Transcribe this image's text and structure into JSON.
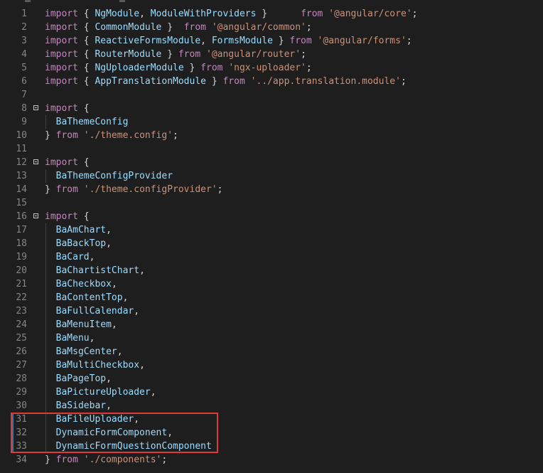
{
  "editor": {
    "lines": [
      {
        "n": "1",
        "fold": false,
        "indent": false,
        "mod": false,
        "t": [
          [
            "kw",
            "import"
          ],
          [
            "pn",
            " { "
          ],
          [
            "id",
            "NgModule"
          ],
          [
            "pn",
            ", "
          ],
          [
            "id",
            "ModuleWithProviders"
          ],
          [
            "pn",
            " }      "
          ],
          [
            "kw",
            "from"
          ],
          [
            "pn",
            " "
          ],
          [
            "str",
            "'@angular/core'"
          ],
          [
            "pn",
            ";"
          ]
        ]
      },
      {
        "n": "2",
        "fold": false,
        "indent": false,
        "mod": false,
        "t": [
          [
            "kw",
            "import"
          ],
          [
            "pn",
            " { "
          ],
          [
            "id",
            "CommonModule"
          ],
          [
            "pn",
            " }  "
          ],
          [
            "kw",
            "from"
          ],
          [
            "pn",
            " "
          ],
          [
            "str",
            "'@angular/common'"
          ],
          [
            "pn",
            ";"
          ]
        ]
      },
      {
        "n": "3",
        "fold": false,
        "indent": false,
        "mod": false,
        "t": [
          [
            "kw",
            "import"
          ],
          [
            "pn",
            " { "
          ],
          [
            "id",
            "ReactiveFormsModule"
          ],
          [
            "pn",
            ", "
          ],
          [
            "id",
            "FormsModule"
          ],
          [
            "pn",
            " } "
          ],
          [
            "kw",
            "from"
          ],
          [
            "pn",
            " "
          ],
          [
            "str",
            "'@angular/forms'"
          ],
          [
            "pn",
            ";"
          ]
        ]
      },
      {
        "n": "4",
        "fold": false,
        "indent": false,
        "mod": false,
        "t": [
          [
            "kw",
            "import"
          ],
          [
            "pn",
            " { "
          ],
          [
            "id",
            "RouterModule"
          ],
          [
            "pn",
            " } "
          ],
          [
            "kw",
            "from"
          ],
          [
            "pn",
            " "
          ],
          [
            "str",
            "'@angular/router'"
          ],
          [
            "pn",
            ";"
          ]
        ]
      },
      {
        "n": "5",
        "fold": false,
        "indent": false,
        "mod": false,
        "t": [
          [
            "kw",
            "import"
          ],
          [
            "pn",
            " { "
          ],
          [
            "id",
            "NgUploaderModule"
          ],
          [
            "pn",
            " } "
          ],
          [
            "kw",
            "from"
          ],
          [
            "pn",
            " "
          ],
          [
            "str",
            "'ngx-uploader'"
          ],
          [
            "pn",
            ";"
          ]
        ]
      },
      {
        "n": "6",
        "fold": false,
        "indent": false,
        "mod": false,
        "t": [
          [
            "kw",
            "import"
          ],
          [
            "pn",
            " { "
          ],
          [
            "id",
            "AppTranslationModule"
          ],
          [
            "pn",
            " } "
          ],
          [
            "kw",
            "from"
          ],
          [
            "pn",
            " "
          ],
          [
            "str",
            "'../app.translation.module'"
          ],
          [
            "pn",
            ";"
          ]
        ]
      },
      {
        "n": "7",
        "fold": false,
        "indent": false,
        "mod": false,
        "t": []
      },
      {
        "n": "8",
        "fold": true,
        "indent": false,
        "mod": false,
        "t": [
          [
            "kw",
            "import"
          ],
          [
            "pn",
            " {"
          ]
        ]
      },
      {
        "n": "9",
        "fold": false,
        "indent": true,
        "mod": false,
        "t": [
          [
            "pn",
            "  "
          ],
          [
            "id",
            "BaThemeConfig"
          ]
        ]
      },
      {
        "n": "10",
        "fold": false,
        "indent": false,
        "mod": false,
        "t": [
          [
            "pn",
            "} "
          ],
          [
            "kw",
            "from"
          ],
          [
            "pn",
            " "
          ],
          [
            "str",
            "'./theme.config'"
          ],
          [
            "pn",
            ";"
          ]
        ]
      },
      {
        "n": "11",
        "fold": false,
        "indent": false,
        "mod": false,
        "t": []
      },
      {
        "n": "12",
        "fold": true,
        "indent": false,
        "mod": false,
        "t": [
          [
            "kw",
            "import"
          ],
          [
            "pn",
            " {"
          ]
        ]
      },
      {
        "n": "13",
        "fold": false,
        "indent": true,
        "mod": false,
        "t": [
          [
            "pn",
            "  "
          ],
          [
            "id",
            "BaThemeConfigProvider"
          ]
        ]
      },
      {
        "n": "14",
        "fold": false,
        "indent": false,
        "mod": false,
        "t": [
          [
            "pn",
            "} "
          ],
          [
            "kw",
            "from"
          ],
          [
            "pn",
            " "
          ],
          [
            "str",
            "'./theme.configProvider'"
          ],
          [
            "pn",
            ";"
          ]
        ]
      },
      {
        "n": "15",
        "fold": false,
        "indent": false,
        "mod": false,
        "t": []
      },
      {
        "n": "16",
        "fold": true,
        "indent": false,
        "mod": false,
        "t": [
          [
            "kw",
            "import"
          ],
          [
            "pn",
            " {"
          ]
        ]
      },
      {
        "n": "17",
        "fold": false,
        "indent": true,
        "mod": false,
        "t": [
          [
            "pn",
            "  "
          ],
          [
            "id",
            "BaAmChart"
          ],
          [
            "pn",
            ","
          ]
        ]
      },
      {
        "n": "18",
        "fold": false,
        "indent": true,
        "mod": false,
        "t": [
          [
            "pn",
            "  "
          ],
          [
            "id",
            "BaBackTop"
          ],
          [
            "pn",
            ","
          ]
        ]
      },
      {
        "n": "19",
        "fold": false,
        "indent": true,
        "mod": false,
        "t": [
          [
            "pn",
            "  "
          ],
          [
            "id",
            "BaCard"
          ],
          [
            "pn",
            ","
          ]
        ]
      },
      {
        "n": "20",
        "fold": false,
        "indent": true,
        "mod": false,
        "t": [
          [
            "pn",
            "  "
          ],
          [
            "id",
            "BaChartistChart"
          ],
          [
            "pn",
            ","
          ]
        ]
      },
      {
        "n": "21",
        "fold": false,
        "indent": true,
        "mod": false,
        "t": [
          [
            "pn",
            "  "
          ],
          [
            "id",
            "BaCheckbox"
          ],
          [
            "pn",
            ","
          ]
        ]
      },
      {
        "n": "22",
        "fold": false,
        "indent": true,
        "mod": false,
        "t": [
          [
            "pn",
            "  "
          ],
          [
            "id",
            "BaContentTop"
          ],
          [
            "pn",
            ","
          ]
        ]
      },
      {
        "n": "23",
        "fold": false,
        "indent": true,
        "mod": false,
        "t": [
          [
            "pn",
            "  "
          ],
          [
            "id",
            "BaFullCalendar"
          ],
          [
            "pn",
            ","
          ]
        ]
      },
      {
        "n": "24",
        "fold": false,
        "indent": true,
        "mod": false,
        "t": [
          [
            "pn",
            "  "
          ],
          [
            "id",
            "BaMenuItem"
          ],
          [
            "pn",
            ","
          ]
        ]
      },
      {
        "n": "25",
        "fold": false,
        "indent": true,
        "mod": false,
        "t": [
          [
            "pn",
            "  "
          ],
          [
            "id",
            "BaMenu"
          ],
          [
            "pn",
            ","
          ]
        ]
      },
      {
        "n": "26",
        "fold": false,
        "indent": true,
        "mod": false,
        "t": [
          [
            "pn",
            "  "
          ],
          [
            "id",
            "BaMsgCenter"
          ],
          [
            "pn",
            ","
          ]
        ]
      },
      {
        "n": "27",
        "fold": false,
        "indent": true,
        "mod": false,
        "t": [
          [
            "pn",
            "  "
          ],
          [
            "id",
            "BaMultiCheckbox"
          ],
          [
            "pn",
            ","
          ]
        ]
      },
      {
        "n": "28",
        "fold": false,
        "indent": true,
        "mod": false,
        "t": [
          [
            "pn",
            "  "
          ],
          [
            "id",
            "BaPageTop"
          ],
          [
            "pn",
            ","
          ]
        ]
      },
      {
        "n": "29",
        "fold": false,
        "indent": true,
        "mod": false,
        "t": [
          [
            "pn",
            "  "
          ],
          [
            "id",
            "BaPictureUploader"
          ],
          [
            "pn",
            ","
          ]
        ]
      },
      {
        "n": "30",
        "fold": false,
        "indent": true,
        "mod": false,
        "t": [
          [
            "pn",
            "  "
          ],
          [
            "id",
            "BaSidebar"
          ],
          [
            "pn",
            ","
          ]
        ]
      },
      {
        "n": "31",
        "fold": false,
        "indent": true,
        "mod": true,
        "t": [
          [
            "pn",
            "  "
          ],
          [
            "id",
            "BaFileUploader"
          ],
          [
            "pn",
            ","
          ]
        ]
      },
      {
        "n": "32",
        "fold": false,
        "indent": true,
        "mod": true,
        "t": [
          [
            "pn",
            "  "
          ],
          [
            "id",
            "DynamicFormComponent"
          ],
          [
            "pn",
            ","
          ]
        ]
      },
      {
        "n": "33",
        "fold": false,
        "indent": true,
        "mod": true,
        "t": [
          [
            "pn",
            "  "
          ],
          [
            "id",
            "DynamicFormQuestionComponent"
          ]
        ]
      },
      {
        "n": "34",
        "fold": false,
        "indent": false,
        "mod": false,
        "t": [
          [
            "pn",
            "} "
          ],
          [
            "kw",
            "from"
          ],
          [
            "pn",
            " "
          ],
          [
            "str",
            "'./components'"
          ],
          [
            "pn",
            ";"
          ]
        ]
      }
    ]
  },
  "colors": {
    "background": "#1e1e1e",
    "line_number": "#858585",
    "keyword": "#c586c0",
    "identifier": "#9cdcfe",
    "string": "#ce9178",
    "punctuation": "#d4d4d4",
    "gutter_modified": "#1b81a8",
    "highlight_box": "#e0393a"
  },
  "icons": {
    "fold": "fold-collapse-icon"
  }
}
